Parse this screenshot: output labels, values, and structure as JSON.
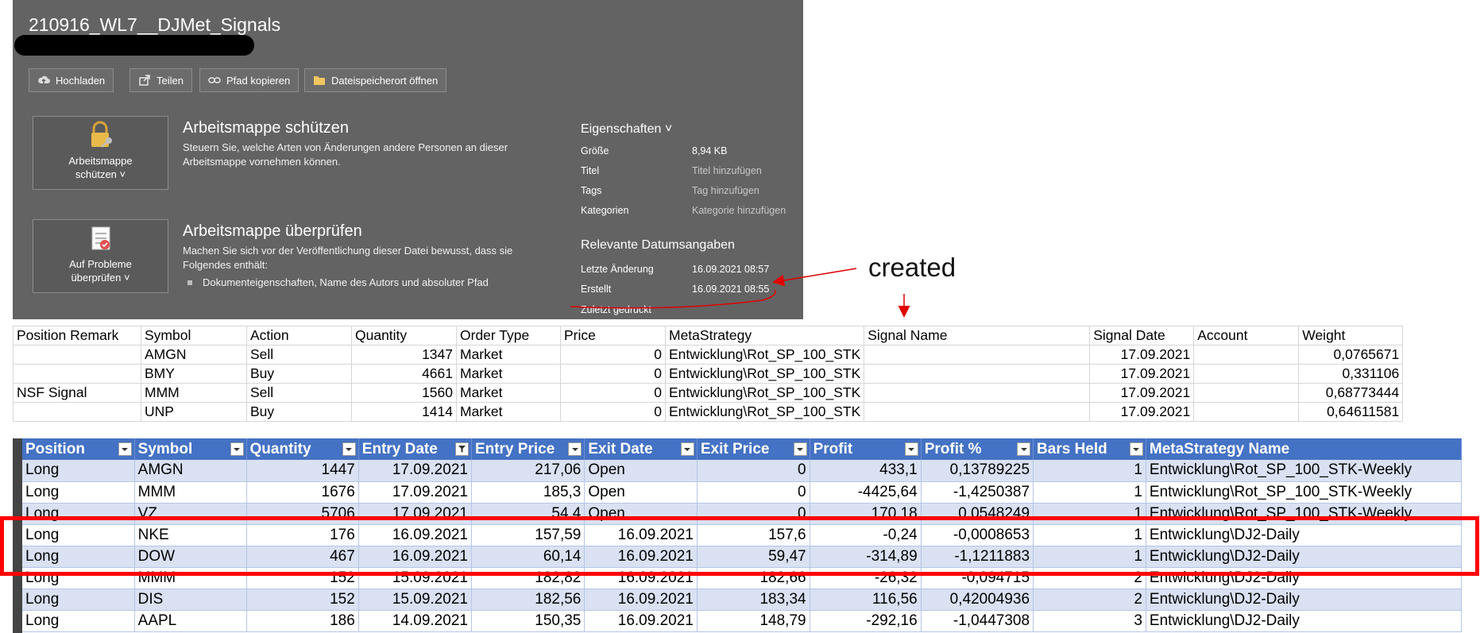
{
  "window": {
    "file_name": "210916_WL7__DJMet_Signals"
  },
  "toolbar": {
    "buttons": [
      {
        "label": "Hochladen",
        "icon": "cloud-upload-icon"
      },
      {
        "label": "Teilen",
        "icon": "share-icon"
      },
      {
        "label": "Pfad kopieren",
        "icon": "link-icon"
      },
      {
        "label": "Dateispeicherort öffnen",
        "icon": "folder-icon"
      }
    ]
  },
  "protect": {
    "button_line1": "Arbeitsmappe",
    "button_line2": "schützen ˅",
    "title": "Arbeitsmappe schützen",
    "description": "Steuern Sie, welche Arten von Änderungen andere Personen an dieser Arbeitsmappe vornehmen können."
  },
  "inspect": {
    "button_line1": "Auf Probleme",
    "button_line2": "überprüfen ˅",
    "title": "Arbeitsmappe überprüfen",
    "description": "Machen Sie sich vor der Veröffentlichung dieser Datei bewusst, dass sie Folgendes enthält:",
    "bullet": "Dokumenteigenschaften, Name des Autors und absoluter Pfad"
  },
  "properties": {
    "heading": "Eigenschaften ˅",
    "rows": [
      {
        "label": "Größe",
        "value": "8,94 KB",
        "muted": false
      },
      {
        "label": "Titel",
        "value": "Titel hinzufügen",
        "muted": true
      },
      {
        "label": "Tags",
        "value": "Tag hinzufügen",
        "muted": true
      },
      {
        "label": "Kategorien",
        "value": "Kategorie hinzufügen",
        "muted": true
      }
    ],
    "dates_heading": "Relevante Datumsangaben",
    "dates": [
      {
        "label": "Letzte Änderung",
        "value": "16.09.2021 08:57"
      },
      {
        "label": "Erstellt",
        "value": "16.09.2021 08:55"
      }
    ],
    "last_printed_label": "Zuletzt gedruckt"
  },
  "annotation": {
    "text": "created"
  },
  "signals_table": {
    "headers": [
      "Position Remark",
      "Symbol",
      "Action",
      "Quantity",
      "Order Type",
      "Price",
      "MetaStrategy",
      "Signal Name",
      "Signal Date",
      "Account",
      "Weight"
    ],
    "rows": [
      [
        "",
        "AMGN",
        "Sell",
        "1347",
        "Market",
        "0",
        "Entwicklung\\Rot_SP_100_STK",
        "",
        "17.09.2021",
        "",
        "0,0765671"
      ],
      [
        "",
        "BMY",
        "Buy",
        "4661",
        "Market",
        "0",
        "Entwicklung\\Rot_SP_100_STK",
        "",
        "17.09.2021",
        "",
        "0,331106"
      ],
      [
        "NSF Signal",
        "MMM",
        "Sell",
        "1560",
        "Market",
        "0",
        "Entwicklung\\Rot_SP_100_STK",
        "",
        "17.09.2021",
        "",
        "0,68773444"
      ],
      [
        "",
        "UNP",
        "Buy",
        "1414",
        "Market",
        "0",
        "Entwicklung\\Rot_SP_100_STK",
        "",
        "17.09.2021",
        "",
        "0,64611581"
      ]
    ]
  },
  "trades_table": {
    "headers": [
      "Position",
      "Symbol",
      "Quantity",
      "Entry Date",
      "Entry Price",
      "Exit Date",
      "Exit Price",
      "Profit",
      "Profit %",
      "Bars Held",
      "MetaStrategy Name"
    ],
    "rows": [
      [
        "Long",
        "AMGN",
        "1447",
        "17.09.2021",
        "217,06",
        "Open",
        "",
        "0",
        "433,1",
        "0,13789225",
        "1",
        "Entwicklung\\Rot_SP_100_STK-Weekly"
      ],
      [
        "Long",
        "MMM",
        "1676",
        "17.09.2021",
        "185,3",
        "Open",
        "",
        "0",
        "-4425,64",
        "-1,4250387",
        "1",
        "Entwicklung\\Rot_SP_100_STK-Weekly"
      ],
      [
        "Long",
        "VZ",
        "5706",
        "17.09.2021",
        "54,4",
        "Open",
        "",
        "0",
        "170,18",
        "0,0548249",
        "1",
        "Entwicklung\\Rot_SP_100_STK-Weekly"
      ],
      [
        "Long",
        "NKE",
        "176",
        "16.09.2021",
        "157,59",
        "16.09.2021",
        "",
        "157,6",
        "-0,24",
        "-0,0008653",
        "1",
        "Entwicklung\\DJ2-Daily"
      ],
      [
        "Long",
        "DOW",
        "467",
        "16.09.2021",
        "60,14",
        "16.09.2021",
        "",
        "59,47",
        "-314,89",
        "-1,1211883",
        "1",
        "Entwicklung\\DJ2-Daily"
      ],
      [
        "Long",
        "MMM",
        "152",
        "15.09.2021",
        "182,82",
        "16.09.2021",
        "",
        "182,66",
        "-26,32",
        "-0,094715",
        "2",
        "Entwicklung\\DJ2-Daily"
      ],
      [
        "Long",
        "DIS",
        "152",
        "15.09.2021",
        "182,56",
        "16.09.2021",
        "",
        "183,34",
        "116,56",
        "0,42004936",
        "2",
        "Entwicklung\\DJ2-Daily"
      ],
      [
        "Long",
        "AAPL",
        "186",
        "14.09.2021",
        "150,35",
        "16.09.2021",
        "",
        "148,79",
        "-292,16",
        "-1,0447308",
        "3",
        "Entwicklung\\DJ2-Daily"
      ]
    ]
  },
  "colors": {
    "pane_bg": "#636363",
    "table_header": "#4472c4",
    "band_row": "#d9e1f2",
    "highlight": "#ff0000"
  }
}
